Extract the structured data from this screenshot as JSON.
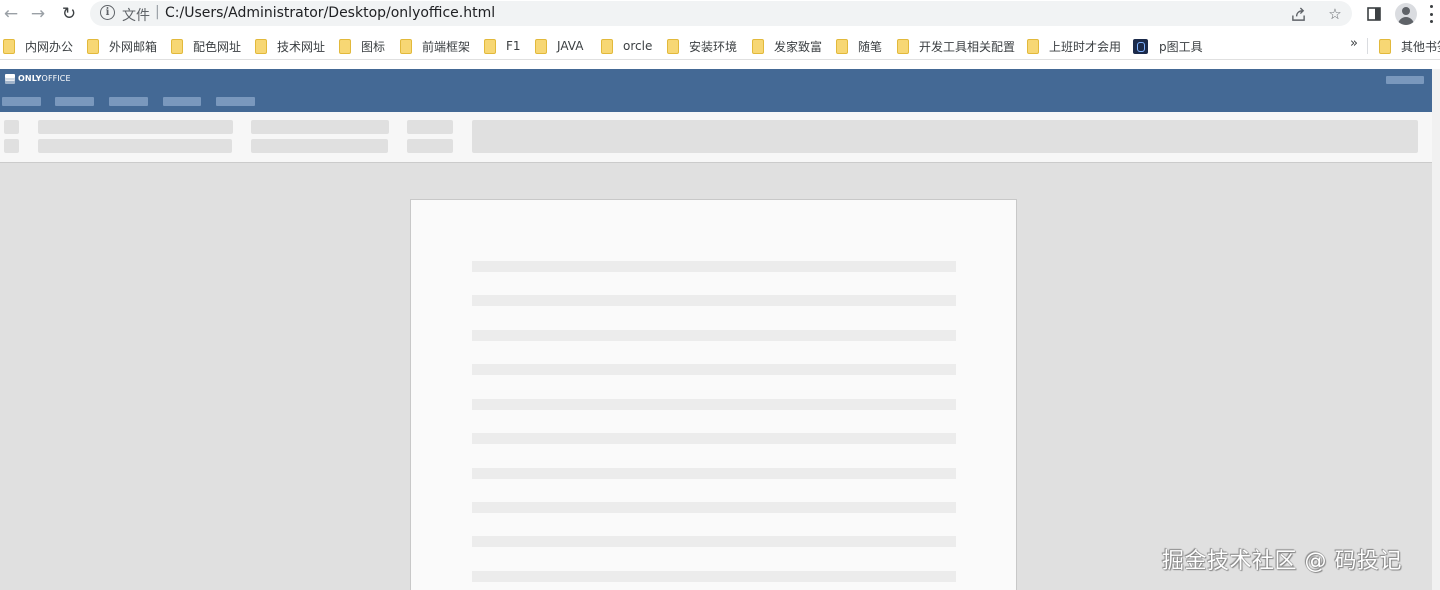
{
  "browser": {
    "address_bar": {
      "scheme_label": "文件",
      "separator": "|",
      "url": "C:/Users/Administrator/Desktop/onlyoffice.html"
    },
    "icons": {
      "back": "back-arrow-icon",
      "forward": "forward-arrow-icon",
      "reload": "reload-icon",
      "info": "info-icon",
      "share": "share-icon",
      "bookmark": "star-icon",
      "side_panel": "side-panel-icon",
      "profile": "profile-icon",
      "menu": "more-menu-icon"
    },
    "bookmarks": [
      {
        "label": "内网办公",
        "icon": "folder-icon"
      },
      {
        "label": "外网邮箱",
        "icon": "folder-icon"
      },
      {
        "label": "配色网址",
        "icon": "folder-icon"
      },
      {
        "label": "技术网址",
        "icon": "folder-icon"
      },
      {
        "label": "图标",
        "icon": "folder-icon"
      },
      {
        "label": "前端框架",
        "icon": "folder-icon"
      },
      {
        "label": "F1",
        "icon": "folder-icon"
      },
      {
        "label": "JAVA",
        "icon": "folder-icon"
      },
      {
        "label": "orcle",
        "icon": "folder-icon"
      },
      {
        "label": "安装环境",
        "icon": "folder-icon"
      },
      {
        "label": "发家致富",
        "icon": "folder-icon"
      },
      {
        "label": "随笔",
        "icon": "folder-icon"
      },
      {
        "label": "开发工具相关配置",
        "icon": "folder-icon"
      },
      {
        "label": "上班时才会用",
        "icon": "folder-icon"
      },
      {
        "label": "p图工具",
        "icon": "app-icon"
      }
    ],
    "bookmarks_overflow": "»",
    "other_bookmarks": "其他书签"
  },
  "onlyoffice": {
    "logo_bold": "ONLY",
    "logo_light": "OFFICE",
    "colors": {
      "header": "#446995",
      "placeholder": "#7a98bd",
      "toolbar": "#f7f7f7",
      "canvas": "#e0e0e0"
    }
  },
  "watermark": "掘金技术社区 @ 码投记"
}
